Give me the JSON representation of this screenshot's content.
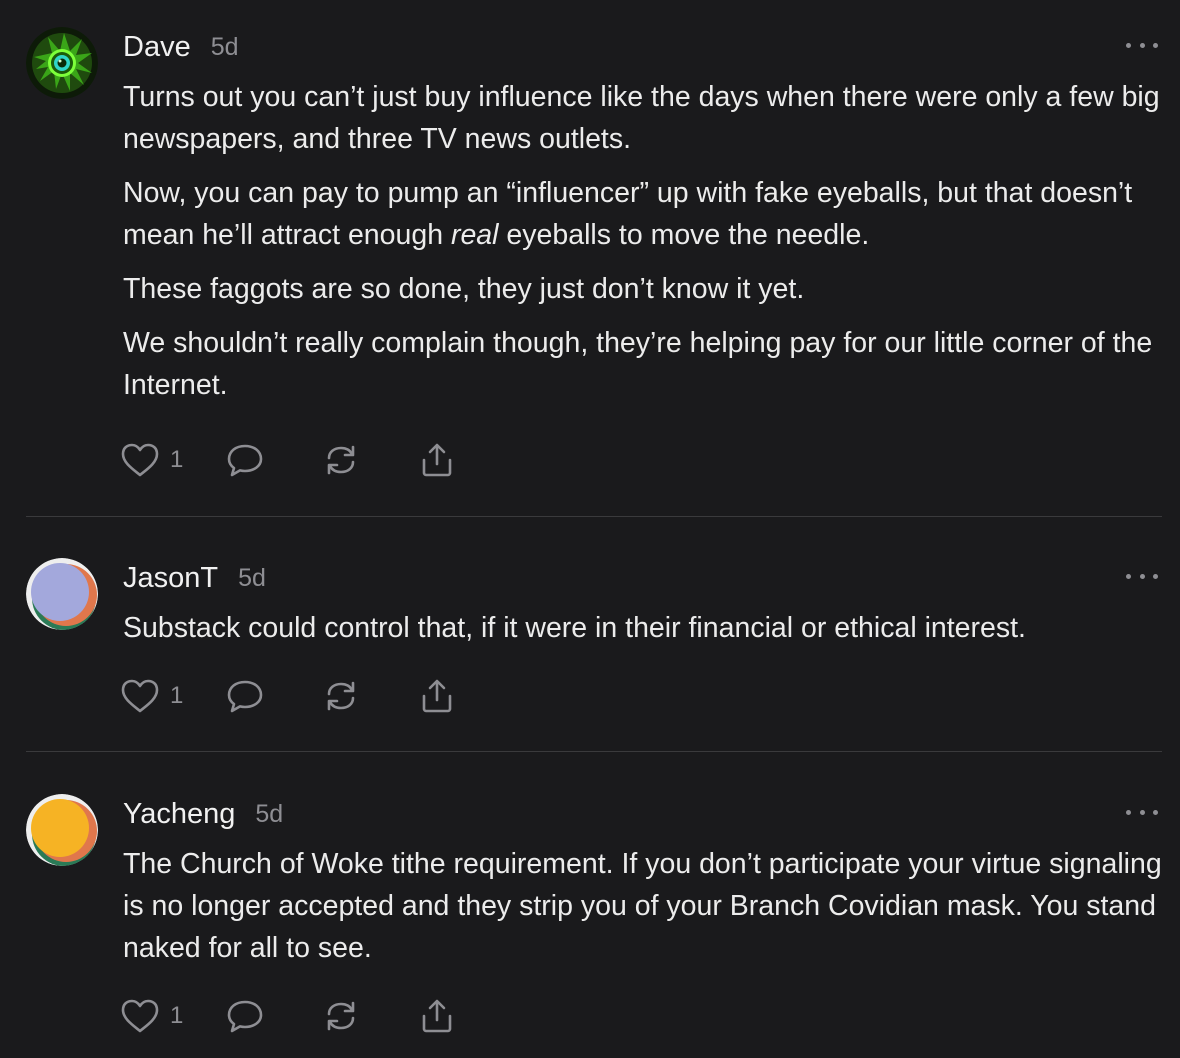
{
  "comments": [
    {
      "author": "Dave",
      "time": "5d",
      "paragraphs": [
        "Turns out you can’t just buy influence like the days when there were only a few big newspapers, and three TV news outlets.",
        "These faggots are so done, they just don’t know it yet.",
        "We shouldn’t really complain though, they’re helping pay for our little corner of the Internet."
      ],
      "p2_before": "Now, you can pay to pump an “influencer” up with fake eyeballs, but that doesn’t mean he’ll attract enough ",
      "p2_em": "real",
      "p2_after": " eyeballs to move the needle.",
      "likes": "1",
      "avatar_icon": "green-eye-avatar"
    },
    {
      "author": "JasonT",
      "time": "5d",
      "paragraphs": [
        "Substack could control that, if it were in their financial or ethical interest."
      ],
      "likes": "1",
      "avatar_icon": "gradient-circle-avatar",
      "avatar_color": "#a3a8dc"
    },
    {
      "author": "Yacheng",
      "time": "5d",
      "paragraphs": [
        "The Church of Woke tithe requirement. If you don’t participate your virtue signaling is no longer accepted and they strip you of your Branch Covidian mask. You stand naked for all to see."
      ],
      "likes": "1",
      "avatar_icon": "gradient-circle-avatar",
      "avatar_color": "#f6b324"
    }
  ],
  "icons": {
    "like": "heart-icon",
    "reply": "speech-bubble-icon",
    "restack": "restack-icon",
    "share": "share-icon",
    "more": "more-dots-icon"
  },
  "colors": {
    "background": "#1a1a1c",
    "text": "#ececec",
    "muted": "#8e8e93",
    "divider": "#3a3a3c"
  }
}
